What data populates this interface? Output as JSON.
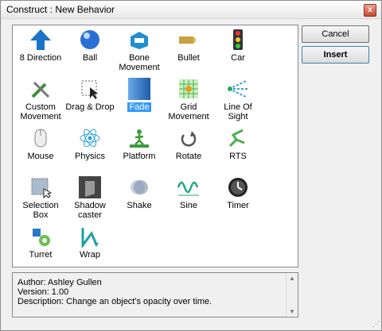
{
  "window": {
    "title": "Construct : New Behavior",
    "close_glyph": "x"
  },
  "buttons": {
    "cancel": "Cancel",
    "insert": "Insert"
  },
  "behaviors": [
    {
      "label": "8 Direction",
      "icon": "arrow-up-icon",
      "color": "#1a72c9"
    },
    {
      "label": "Ball",
      "icon": "ball-icon",
      "color": "#2a6fd6"
    },
    {
      "label": "Bone Movement",
      "icon": "bone-icon",
      "color": "#1f8fd0"
    },
    {
      "label": "Bullet",
      "icon": "bullet-icon",
      "color": "#c9a040"
    },
    {
      "label": "Car",
      "icon": "traffic-light-icon",
      "color": "#333333"
    },
    {
      "label": "Custom Movement",
      "icon": "tools-icon",
      "color": "#3b8f3b"
    },
    {
      "label": "Drag & Drop",
      "icon": "drag-icon",
      "color": "#555555"
    },
    {
      "label": "Fade",
      "icon": "fade-icon",
      "color": "#2f6fc0"
    },
    {
      "label": "Grid Movement",
      "icon": "grid-icon",
      "color": "#4caf50"
    },
    {
      "label": "Line Of Sight",
      "icon": "line-of-sight-icon",
      "color": "#3aa0d0"
    },
    {
      "label": "Mouse",
      "icon": "mouse-icon",
      "color": "#888888"
    },
    {
      "label": "Physics",
      "icon": "atom-icon",
      "color": "#2aa0d8"
    },
    {
      "label": "Platform",
      "icon": "platform-icon",
      "color": "#3d9b3d"
    },
    {
      "label": "Rotate",
      "icon": "rotate-icon",
      "color": "#555555"
    },
    {
      "label": "RTS",
      "icon": "rts-icon",
      "color": "#4caf50"
    },
    {
      "label": "Selection Box",
      "icon": "selection-box-icon",
      "color": "#6a7d90"
    },
    {
      "label": "Shadow caster",
      "icon": "shadow-caster-icon",
      "color": "#444444"
    },
    {
      "label": "Shake",
      "icon": "shake-icon",
      "color": "#7f8fa8"
    },
    {
      "label": "Sine",
      "icon": "sine-icon",
      "color": "#1fa87a"
    },
    {
      "label": "Timer",
      "icon": "timer-icon",
      "color": "#222222"
    },
    {
      "label": "Turret",
      "icon": "turret-icon",
      "color": "#2a78c8"
    },
    {
      "label": "Wrap",
      "icon": "wrap-icon",
      "color": "#1fa0a0"
    }
  ],
  "selected_behavior": "Fade",
  "description": {
    "author": "Author: Ashley Gullen",
    "version": "Version: 1.00",
    "text": "Description: Change an object's opacity over time."
  }
}
